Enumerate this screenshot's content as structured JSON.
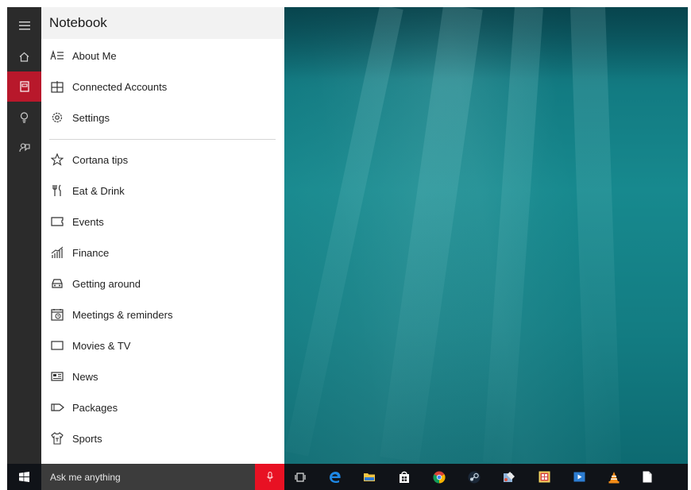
{
  "panel": {
    "title": "Notebook",
    "top_items": [
      {
        "label": "About Me",
        "icon": "about-me-icon"
      },
      {
        "label": "Connected Accounts",
        "icon": "connected-accounts-icon"
      },
      {
        "label": "Settings",
        "icon": "settings-gear-icon"
      }
    ],
    "items": [
      {
        "label": "Cortana tips",
        "icon": "star-icon"
      },
      {
        "label": "Eat & Drink",
        "icon": "fork-knife-icon"
      },
      {
        "label": "Events",
        "icon": "ticket-icon"
      },
      {
        "label": "Finance",
        "icon": "finance-chart-icon"
      },
      {
        "label": "Getting around",
        "icon": "car-icon"
      },
      {
        "label": "Meetings & reminders",
        "icon": "calendar-icon"
      },
      {
        "label": "Movies & TV",
        "icon": "tv-icon"
      },
      {
        "label": "News",
        "icon": "news-icon"
      },
      {
        "label": "Packages",
        "icon": "package-icon"
      },
      {
        "label": "Sports",
        "icon": "sports-jersey-icon"
      }
    ]
  },
  "rail": {
    "buttons": [
      "hamburger-menu-icon",
      "home-icon",
      "notebook-icon",
      "lightbulb-icon",
      "feedback-icon"
    ],
    "active": "notebook-icon"
  },
  "taskbar": {
    "search_placeholder": "Ask me anything",
    "apps": [
      "task-view-icon",
      "edge-icon",
      "file-explorer-icon",
      "store-icon",
      "chrome-icon",
      "steam-icon",
      "paint-icon",
      "calculator-icon",
      "media-icon",
      "vlc-icon",
      "notepad-icon"
    ]
  },
  "colors": {
    "accent": "#e81123",
    "rail_active": "#b8182b",
    "rail_bg": "#2b2b2b",
    "taskbar_bg": "#101318",
    "search_bg": "#3c3c3c"
  }
}
